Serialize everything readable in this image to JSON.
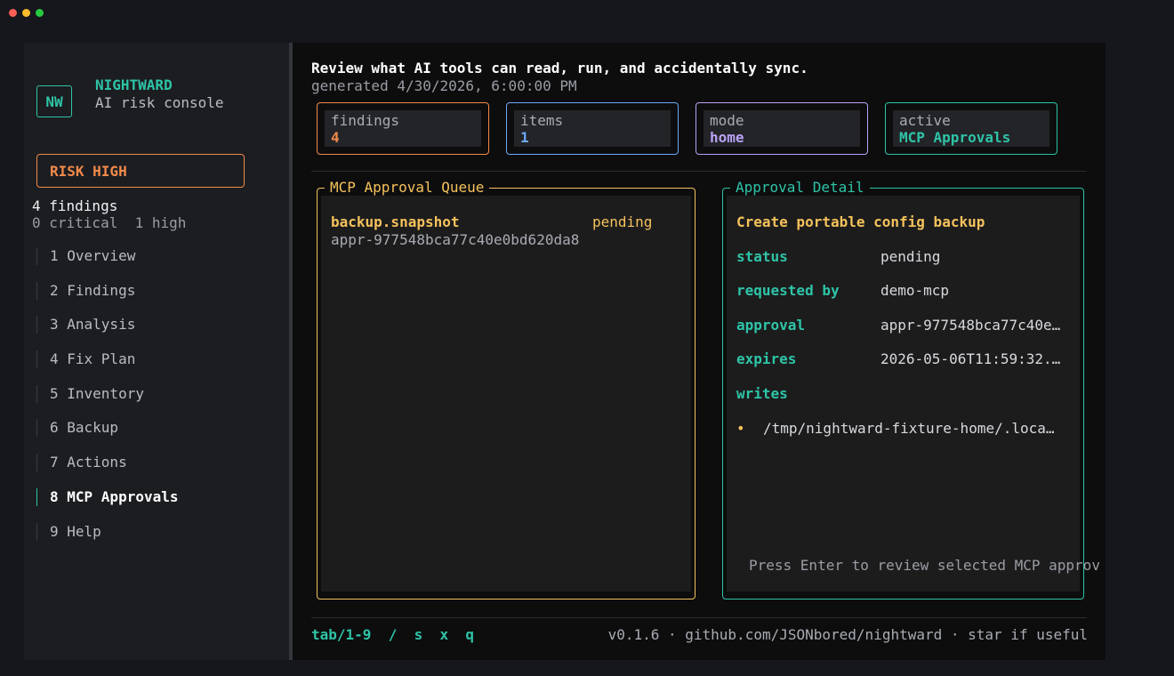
{
  "app": {
    "logo_text": "NW",
    "name": "NIGHTWARD",
    "subtitle": "AI risk console"
  },
  "risk": {
    "label": "RISK HIGH",
    "findings_count": "4 findings",
    "breakdown": "0 critical  1 high"
  },
  "nav": {
    "items": [
      {
        "label": "1 Overview"
      },
      {
        "label": "2 Findings"
      },
      {
        "label": "3 Analysis"
      },
      {
        "label": "4 Fix Plan"
      },
      {
        "label": "5 Inventory"
      },
      {
        "label": "6 Backup"
      },
      {
        "label": "7 Actions"
      },
      {
        "label": "8 MCP Approvals",
        "active": true
      },
      {
        "label": "9 Help"
      }
    ]
  },
  "header": {
    "headline": "Review what AI tools can read, run, and accidentally sync.",
    "generated": "generated 4/30/2026, 6:00:00 PM"
  },
  "stats": [
    {
      "label": "findings",
      "value": "4",
      "color": "#f28a4a"
    },
    {
      "label": "items",
      "value": "1",
      "color": "#6ea8f7"
    },
    {
      "label": "mode",
      "value": "home",
      "color": "#b9a2f5"
    },
    {
      "label": "active",
      "value": "MCP Approvals",
      "color": "#2ec4a7"
    }
  ],
  "queue": {
    "title": "MCP Approval Queue",
    "items": [
      {
        "name": "backup.snapshot",
        "status": "pending",
        "id": "appr-977548bca77c40e0bd620da8"
      }
    ]
  },
  "detail": {
    "title": "Approval Detail",
    "heading": "Create portable config backup",
    "fields": [
      {
        "key": "status",
        "value": "pending"
      },
      {
        "key": "requested by",
        "value": "demo-mcp"
      },
      {
        "key": "approval",
        "value": "appr-977548bca77c40e…"
      },
      {
        "key": "expires",
        "value": "2026-05-06T11:59:32.…"
      },
      {
        "key": "writes",
        "value": ""
      }
    ],
    "writes": [
      "/tmp/nightward-fixture-home/.loca…"
    ],
    "hint": "Press Enter to review selected MCP approv"
  },
  "footer": {
    "keys": "tab/1-9  /  s  x  q",
    "info": "v0.1.6 · github.com/JSONbored/nightward · star if useful"
  },
  "colors": {
    "accent": "#2ec4a7",
    "warning": "#f5c25b",
    "risk": "#f28a4a"
  }
}
